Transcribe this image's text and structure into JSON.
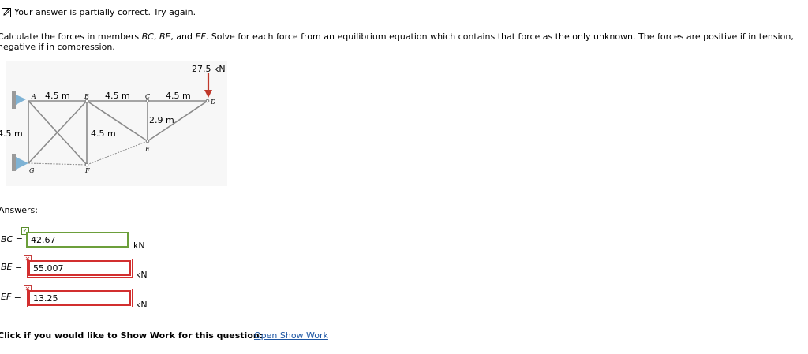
{
  "status": {
    "icon": "pencil-icon",
    "message": "Your answer is partially correct.  Try again."
  },
  "question": {
    "part1": "Calculate the forces in members ",
    "m1": "BC",
    "sep1": ", ",
    "m2": "BE",
    "sep2": ", and ",
    "m3": "EF",
    "part2": ". Solve for each force from an equilibrium equation which contains that force as the only unknown. The forces are positive if in tension, negative if in compression."
  },
  "figure": {
    "load": "27.5 kN",
    "dim_ab": "4.5 m",
    "dim_bc": "4.5 m",
    "dim_cd": "4.5 m",
    "dim_ce": "2.9 m",
    "dim_bf": "4.5 m",
    "dim_ag": "4.5 m",
    "nodes": {
      "A": "A",
      "B": "B",
      "C": "C",
      "D": "D",
      "E": "E",
      "F": "F",
      "G": "G"
    },
    "load_color": "#c0392b"
  },
  "answers": {
    "label": "Answers:",
    "rows": [
      {
        "name": "BC =",
        "value": "42.67",
        "unit": "kN",
        "status": "correct"
      },
      {
        "name": "BE =",
        "value": "55.007",
        "unit": "kN",
        "status": "incorrect"
      },
      {
        "name": "EF =",
        "value": "13.25",
        "unit": "kN",
        "status": "incorrect"
      }
    ]
  },
  "footer": {
    "prompt": "Click if you would like to Show Work for this question:",
    "link": "Open Show Work"
  },
  "colors": {
    "correct": "#6c9f3b",
    "incorrect": "#d22f2f",
    "link": "#1c55a3"
  }
}
